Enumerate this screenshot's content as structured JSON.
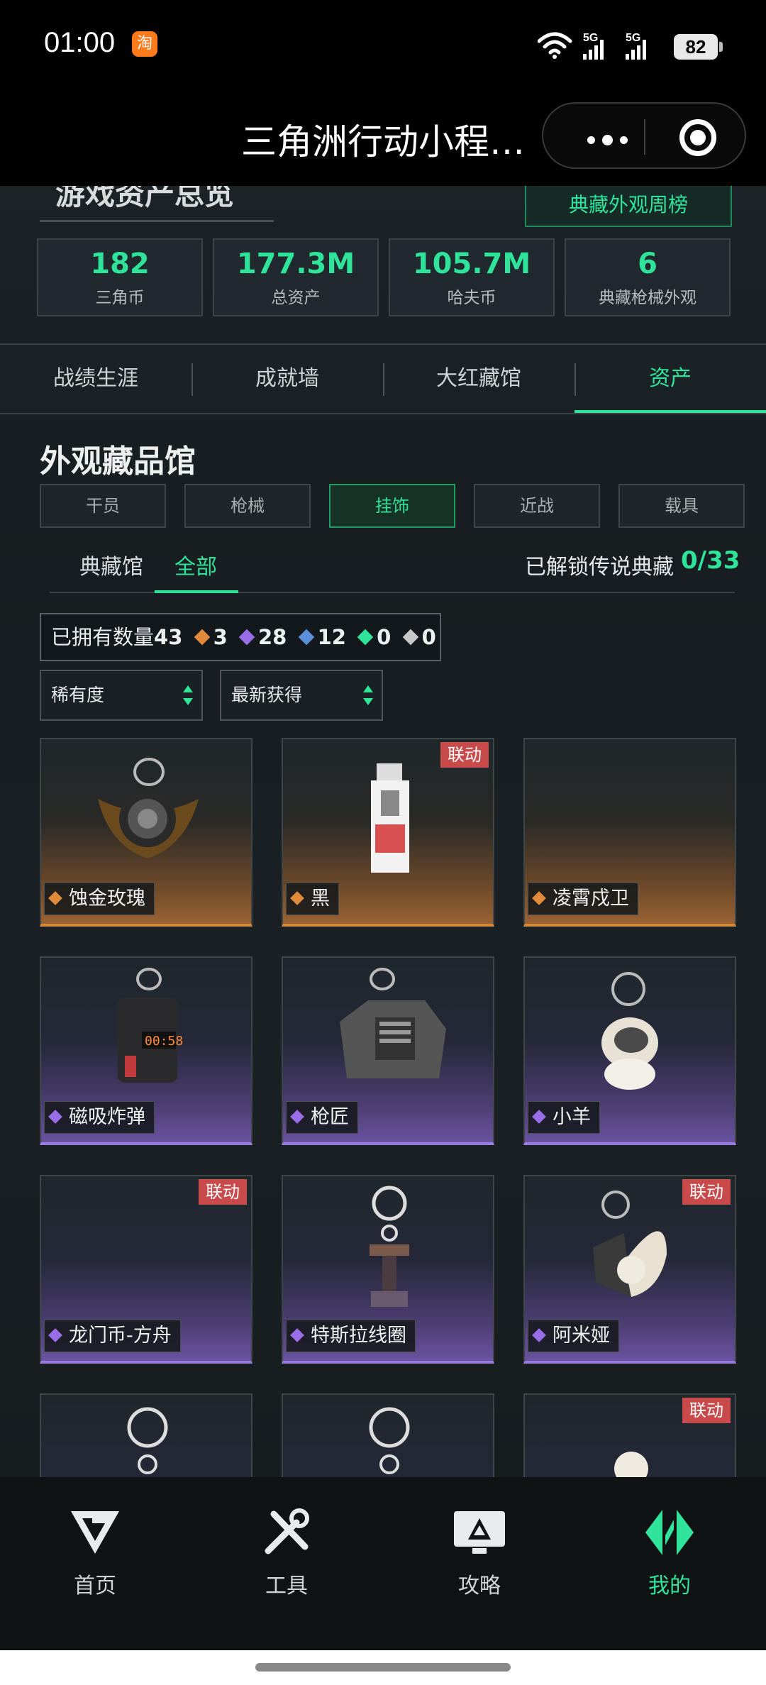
{
  "status_bar": {
    "time": "01:00",
    "app_badge": "淘",
    "network1": "5G",
    "network2": "5G",
    "battery": "82"
  },
  "title_bar": {
    "title": "三角洲行动小程…"
  },
  "overview": {
    "heading": "游戏资产总览",
    "weekly_button": "典藏外观周榜",
    "stats": [
      {
        "value": "182",
        "label": "三角币"
      },
      {
        "value": "177.3M",
        "label": "总资产"
      },
      {
        "value": "105.7M",
        "label": "哈夫币"
      },
      {
        "value": "6",
        "label": "典藏枪械外观"
      }
    ]
  },
  "tabs": [
    "战绩生涯",
    "成就墙",
    "大红藏馆",
    "资产"
  ],
  "active_tab": "资产",
  "collection": {
    "title": "外观藏品馆",
    "categories": [
      "干员",
      "枪械",
      "挂饰",
      "近战",
      "载具"
    ],
    "active_category": "挂饰",
    "subtabs": [
      "典藏馆",
      "全部"
    ],
    "legend_unlock_label": "已解锁传说典藏",
    "legend_unlock_count": "0/33",
    "owned_label": "已拥有数量",
    "owned_total": "43",
    "rarity_counts": [
      {
        "rarity": "gold",
        "color": "#e08a3c",
        "count": "3"
      },
      {
        "rarity": "purple",
        "color": "#9a6ee8",
        "count": "28"
      },
      {
        "rarity": "blue",
        "color": "#5a8fd8",
        "count": "12"
      },
      {
        "rarity": "green",
        "color": "#2fe39a",
        "count": "0"
      },
      {
        "rarity": "white",
        "color": "#c8c8c8",
        "count": "0"
      }
    ],
    "sort_rarity": "稀有度",
    "sort_time": "最新获得",
    "items": [
      {
        "name": "蚀金玫瑰",
        "rarity": "gold",
        "collab": ""
      },
      {
        "name": "黑",
        "rarity": "gold",
        "collab": "联动"
      },
      {
        "name": "凌霄戍卫",
        "rarity": "gold",
        "collab": ""
      },
      {
        "name": "磁吸炸弹",
        "rarity": "purple",
        "collab": ""
      },
      {
        "name": "枪匠",
        "rarity": "purple",
        "collab": ""
      },
      {
        "name": "小羊",
        "rarity": "purple",
        "collab": ""
      },
      {
        "name": "龙门币-方舟",
        "rarity": "purple",
        "collab": "联动"
      },
      {
        "name": "特斯拉线圈",
        "rarity": "purple",
        "collab": ""
      },
      {
        "name": "阿米娅",
        "rarity": "purple",
        "collab": "联动"
      },
      {
        "name": "",
        "rarity": "purple",
        "collab": ""
      },
      {
        "name": "",
        "rarity": "purple",
        "collab": ""
      },
      {
        "name": "",
        "rarity": "purple",
        "collab": "联动"
      }
    ]
  },
  "bottom_nav": [
    {
      "label": "首页",
      "icon": "home-logo-icon"
    },
    {
      "label": "工具",
      "icon": "tools-icon"
    },
    {
      "label": "攻略",
      "icon": "guide-icon"
    },
    {
      "label": "我的",
      "icon": "profile-logo-icon"
    }
  ],
  "colors": {
    "accent": "#2fe39a",
    "gold": "#d28a3a",
    "purple": "#9a7be0",
    "collab": "#c84a4a"
  }
}
